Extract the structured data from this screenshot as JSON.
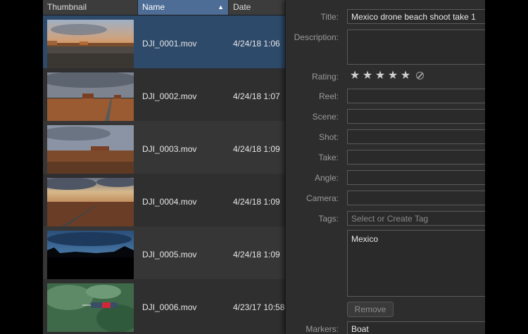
{
  "list": {
    "columns": {
      "thumbnail": "Thumbnail",
      "name": "Name",
      "date": "Date"
    },
    "rows": [
      {
        "name": "DJI_0001.mov",
        "date": "4/24/18 1:06",
        "selected": true
      },
      {
        "name": "DJI_0002.mov",
        "date": "4/24/18 1:07"
      },
      {
        "name": "DJI_0003.mov",
        "date": "4/24/18 1:09"
      },
      {
        "name": "DJI_0004.mov",
        "date": "4/24/18 1:09"
      },
      {
        "name": "DJI_0005.mov",
        "date": "4/24/18 1:09"
      },
      {
        "name": "DJI_0006.mov",
        "date": "4/23/17 10:58"
      }
    ]
  },
  "inspector": {
    "title": {
      "label": "Title:",
      "value": "Mexico drone beach shoot take 1"
    },
    "description": {
      "label": "Description:",
      "value": ""
    },
    "rating": {
      "label": "Rating:",
      "stars": 5,
      "max": 5
    },
    "reel": {
      "label": "Reel:",
      "value": ""
    },
    "scene": {
      "label": "Scene:",
      "value": ""
    },
    "shot": {
      "label": "Shot:",
      "value": ""
    },
    "take": {
      "label": "Take:",
      "value": ""
    },
    "angle": {
      "label": "Angle:",
      "value": ""
    },
    "camera": {
      "label": "Camera:",
      "value": ""
    },
    "tags": {
      "label": "Tags:",
      "placeholder": "Select or Create Tag",
      "items": [
        "Mexico"
      ]
    },
    "remove_label": "Remove",
    "markers": {
      "label": "Markers:",
      "value": "Boat"
    }
  }
}
